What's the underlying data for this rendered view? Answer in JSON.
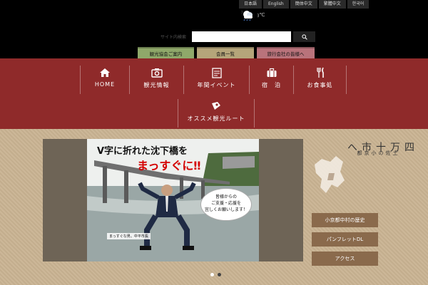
{
  "languages": [
    "日本語",
    "English",
    "簡体中文",
    "繁體中文",
    "한국어"
  ],
  "header": {
    "site_prefix": "ﾌ",
    "weather_temp": "ｮ℃"
  },
  "search": {
    "label": "サイト内検索",
    "placeholder": ""
  },
  "subnav": [
    "観光協会ご案内",
    "会員一覧",
    "旅行会社の皆様へ"
  ],
  "mainnav": {
    "row1": [
      {
        "label": "HOME",
        "icon": "home-icon"
      },
      {
        "label": "観光情報",
        "icon": "camera-icon"
      },
      {
        "label": "年間イベント",
        "icon": "calendar-icon"
      },
      {
        "label": "宿　泊",
        "icon": "suitcase-icon"
      },
      {
        "label": "お食事処",
        "icon": "fork-knife-icon"
      }
    ],
    "row2": [
      {
        "label": "オススメ観光ルート",
        "icon": "map-pin-icon"
      }
    ]
  },
  "slider": {
    "title": "V字に折れた沈下橋を",
    "emphasis": "まっすぐに‼",
    "speech_lines": [
      "皆様からの",
      "ご支援・応援を",
      "宜しくお願いします！"
    ],
    "caption": "まっすぐな男。中平市長",
    "slide_count": 2,
    "active_slide": 1
  },
  "side": {
    "title_main": "四万十市へ",
    "title_sub": "土佐の小京都",
    "buttons": [
      "小京都中村の歴史",
      "パンフレットDL",
      "アクセス"
    ]
  },
  "colors": {
    "menu_red": "#8f2a2a",
    "beige": "#c9b392",
    "side_button": "#8a6a4c"
  }
}
